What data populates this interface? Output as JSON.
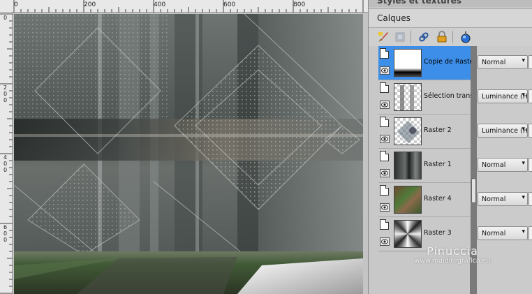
{
  "rulers": {
    "top_labels": [
      "0",
      "200",
      "400",
      "600",
      "800"
    ],
    "left_labels": [
      [
        "0"
      ],
      [
        "2",
        "0",
        "0"
      ],
      [
        "4",
        "0",
        "0"
      ],
      [
        "6",
        "0",
        "0"
      ]
    ]
  },
  "panels": {
    "styles_title": "Styles et textures",
    "layers_title": "Calques"
  },
  "toolbar": {
    "icons": [
      "paint-brush-icon",
      "mask-icon",
      "link-icon",
      "lock-icon",
      "globe-ball-icon"
    ]
  },
  "layers": [
    {
      "name": "Copie de Raster",
      "blend": "Normal",
      "selected": true,
      "thumb": "black-white-gradient"
    },
    {
      "name": "Sélection transfo",
      "blend": "Luminance (H)",
      "selected": false,
      "thumb": "textured-columns"
    },
    {
      "name": "Raster 2",
      "blend": "Luminance (H)",
      "selected": false,
      "thumb": "dotted-pattern"
    },
    {
      "name": "Raster 1",
      "blend": "Normal",
      "selected": false,
      "thumb": "dark-metal"
    },
    {
      "name": "Raster 4",
      "blend": "Normal",
      "selected": false,
      "thumb": "green-brown-texture"
    },
    {
      "name": "Raster 3",
      "blend": "Normal",
      "selected": false,
      "thumb": "radial-silver"
    }
  ],
  "watermark": {
    "title": "Pinuccia",
    "url": "www.maidiregrafica.eu"
  },
  "colors": {
    "selected_row": "#3d8ee8",
    "image_base": "#5b6260",
    "floor_green": "#3f5a35"
  }
}
